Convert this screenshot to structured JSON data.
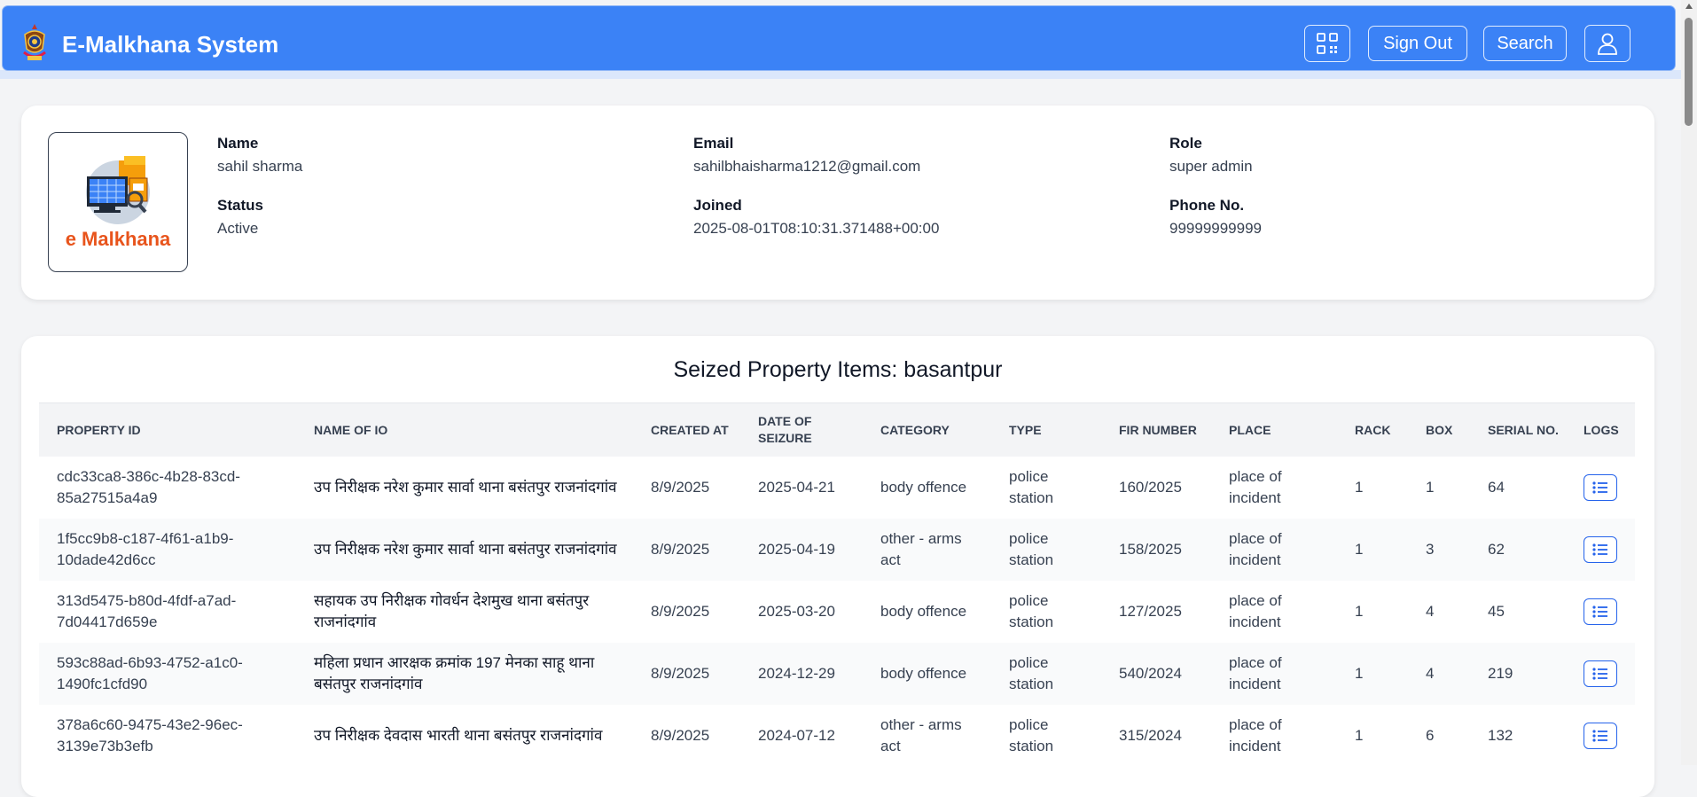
{
  "app": {
    "title": "E-Malkhana System",
    "accent_color": "#3b82f6"
  },
  "nav": {
    "qr_icon": "qr-code-icon",
    "sign_out_label": "Sign Out",
    "search_label": "Search",
    "user_icon": "user-icon"
  },
  "profile": {
    "avatar_text": "e Malkhana",
    "name_label": "Name",
    "name": "sahil sharma",
    "email_label": "Email",
    "email": "sahilbhaisharma1212@gmail.com",
    "role_label": "Role",
    "role": "super admin",
    "status_label": "Status",
    "status": "Active",
    "joined_label": "Joined",
    "joined": "2025-08-01T08:10:31.371488+00:00",
    "phone_label": "Phone No.",
    "phone": "99999999999"
  },
  "table": {
    "title": "Seized Property Items: basantpur",
    "columns": [
      "PROPERTY ID",
      "NAME OF IO",
      "CREATED AT",
      "DATE OF SEIZURE",
      "CATEGORY",
      "TYPE",
      "FIR NUMBER",
      "PLACE",
      "RACK",
      "BOX",
      "SERIAL NO.",
      "LOGS"
    ],
    "rows": [
      {
        "property_id": "cdc33ca8-386c-4b28-83cd-85a27515a4a9",
        "name_of_io": "उप निरीक्षक नरेश कुमार सार्वा थाना बसंतपुर राजनांदगांव",
        "created_at": "8/9/2025",
        "date_of_seizure": "2025-04-21",
        "category": "body offence",
        "type": "police station",
        "fir_number": "160/2025",
        "place": "place of incident",
        "rack": "1",
        "box": "1",
        "serial_no": "64"
      },
      {
        "property_id": "1f5cc9b8-c187-4f61-a1b9-10dade42d6cc",
        "name_of_io": "उप निरीक्षक नरेश कुमार सार्वा थाना बसंतपुर राजनांदगांव",
        "created_at": "8/9/2025",
        "date_of_seizure": "2025-04-19",
        "category": "other - arms act",
        "type": "police station",
        "fir_number": "158/2025",
        "place": "place of incident",
        "rack": "1",
        "box": "3",
        "serial_no": "62"
      },
      {
        "property_id": "313d5475-b80d-4fdf-a7ad-7d04417d659e",
        "name_of_io": "सहायक उप निरीक्षक गोवर्धन देशमुख थाना बसंतपुर राजनांदगांव",
        "created_at": "8/9/2025",
        "date_of_seizure": "2025-03-20",
        "category": "body offence",
        "type": "police station",
        "fir_number": "127/2025",
        "place": "place of incident",
        "rack": "1",
        "box": "4",
        "serial_no": "45"
      },
      {
        "property_id": "593c88ad-6b93-4752-a1c0-1490fc1cfd90",
        "name_of_io": "महिला प्रधान आरक्षक क्रमांक 197 मेनका साहू थाना बसंतपुर राजनांदगांव",
        "created_at": "8/9/2025",
        "date_of_seizure": "2024-12-29",
        "category": "body offence",
        "type": "police station",
        "fir_number": "540/2024",
        "place": "place of incident",
        "rack": "1",
        "box": "4",
        "serial_no": "219"
      },
      {
        "property_id": "378a6c60-9475-43e2-96ec-3139e73b3efb",
        "name_of_io": "उप निरीक्षक देवदास भारती थाना बसंतपुर राजनांदगांव",
        "created_at": "8/9/2025",
        "date_of_seizure": "2024-07-12",
        "category": "other - arms act",
        "type": "police station",
        "fir_number": "315/2024",
        "place": "place of incident",
        "rack": "1",
        "box": "6",
        "serial_no": "132"
      }
    ]
  }
}
